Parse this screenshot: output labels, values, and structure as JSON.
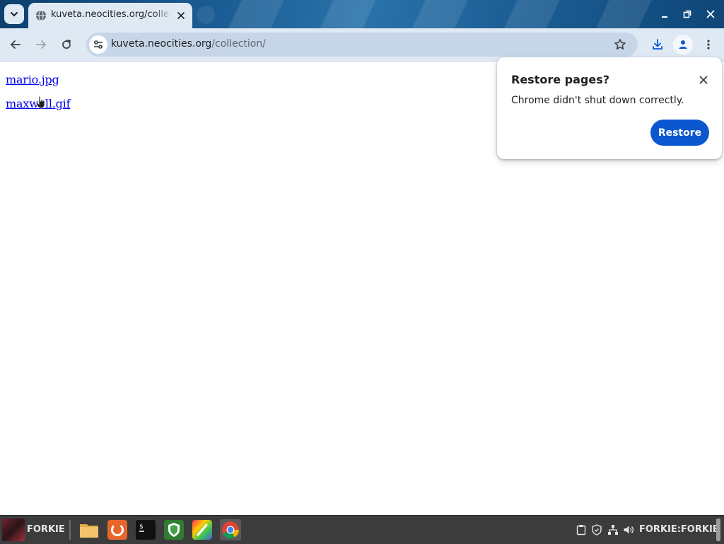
{
  "browser": {
    "tab": {
      "title": "kuveta.neocities.org/collection/"
    },
    "address_bar": {
      "host": "kuveta.neocities.org",
      "path": "/collection/"
    },
    "icons": {
      "tab_search": "chevron-down-icon",
      "tab_favicon": "globe-icon",
      "tab_close": "close-icon",
      "back": "arrow-left-icon",
      "forward": "arrow-right-icon",
      "reload": "reload-icon",
      "site_info": "tune-icon",
      "bookmark": "star-icon",
      "downloads": "download-icon",
      "profile": "person-icon",
      "menu": "kebab-menu-icon",
      "minimize": "minimize-icon",
      "restore_window": "restore-window-icon",
      "close_window": "close-icon"
    }
  },
  "page": {
    "links": [
      {
        "text": "mario.jpg"
      },
      {
        "text": "maxwell.gif"
      }
    ]
  },
  "restore_bubble": {
    "title": "Restore pages?",
    "message": "Chrome didn't shut down correctly.",
    "button_label": "Restore"
  },
  "taskbar": {
    "start_label": "FORKIE",
    "launchers": [
      "file-manager-icon",
      "firefox-icon",
      "terminal-icon",
      "shield-app-icon",
      "paint-app-icon",
      "chrome-icon"
    ],
    "tray_icons": [
      "clipboard-icon",
      "security-icon",
      "network-icon",
      "volume-icon"
    ],
    "user_label": "FORKIE:FORKIE"
  },
  "colors": {
    "accent_button": "#0b57d0",
    "link": "#0000ee",
    "toolbar": "#dfe9f4",
    "omnibox": "#c6d6e8",
    "taskbar": "#3c3c3c"
  }
}
